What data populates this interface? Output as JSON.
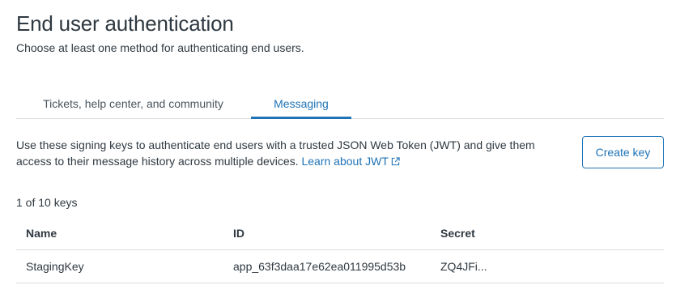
{
  "header": {
    "title": "End user authentication",
    "subtitle": "Choose at least one method for authenticating end users."
  },
  "tabs": [
    {
      "label": "Tickets, help center, and community",
      "active": false
    },
    {
      "label": "Messaging",
      "active": true
    }
  ],
  "messaging": {
    "description": "Use these signing keys to authenticate end users with a trusted JSON Web Token (JWT) and give them access to their message history across multiple devices.",
    "learn_link": "Learn about JWT",
    "link_icon": "external-link-icon",
    "create_button": "Create key",
    "count_text": "1 of 10 keys"
  },
  "table": {
    "columns": [
      "Name",
      "ID",
      "Secret"
    ],
    "rows": [
      {
        "name": "StagingKey",
        "id": "app_63f3daa17e62ea011995d53b",
        "secret": "ZQ4JFi..."
      }
    ]
  },
  "colors": {
    "accent": "#1f73b7",
    "text": "#2f3941",
    "border": "#d8dcde"
  }
}
